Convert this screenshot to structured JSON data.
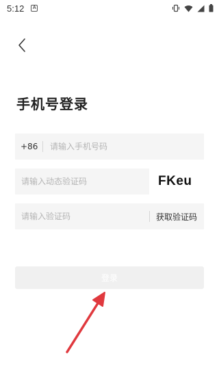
{
  "status_bar": {
    "time": "5:12",
    "notification_icon": "a-icon",
    "right_icons": [
      "vibrate-icon",
      "wifi-icon",
      "signal-icon",
      "battery-icon"
    ]
  },
  "header": {
    "back_icon": "chevron-left-icon"
  },
  "page": {
    "title": "手机号登录"
  },
  "form": {
    "phone": {
      "country_code": "+86",
      "value": "",
      "placeholder": "请输入手机号码"
    },
    "captcha": {
      "value": "",
      "placeholder": "请输入动态验证码",
      "image_text": "FKeu"
    },
    "sms_code": {
      "value": "",
      "placeholder": "请输入验证码",
      "get_code_label": "获取验证码"
    },
    "login_button_label": "登录"
  },
  "colors": {
    "field_background": "#f5f5f5",
    "button_background": "#f0f0f0",
    "annotation_arrow": "#e0393e"
  }
}
